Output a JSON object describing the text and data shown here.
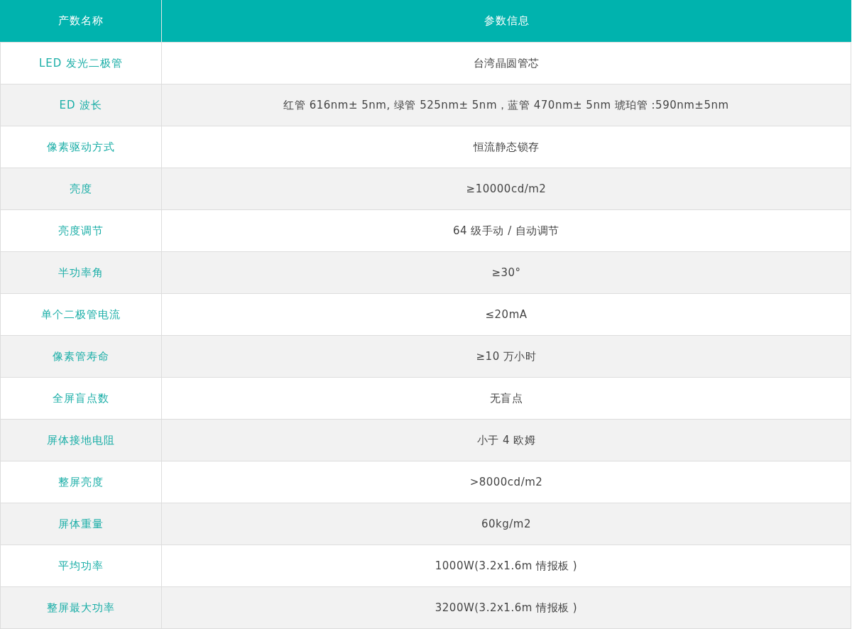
{
  "table": {
    "columns": [
      "产数名称",
      "参数信息"
    ],
    "rows": [
      {
        "name": "LED 发光二极管",
        "value": "台湾晶圆管芯"
      },
      {
        "name": "ED 波长",
        "value": "红管 616nm± 5nm, 绿管 525nm± 5nm，蓝管 470nm± 5nm 琥珀管 :590nm±5nm"
      },
      {
        "name": "像素驱动方式",
        "value": "恒流静态锁存"
      },
      {
        "name": "亮度",
        "value": "≥10000cd/m2"
      },
      {
        "name": "亮度调节",
        "value": "64 级手动 / 自动调节"
      },
      {
        "name": "半功率角",
        "value": "≥30°"
      },
      {
        "name": "单个二极管电流",
        "value": "≤20mA"
      },
      {
        "name": "像素管寿命",
        "value": "≥10 万小时"
      },
      {
        "name": "全屏盲点数",
        "value": "无盲点"
      },
      {
        "name": "屏体接地电阻",
        "value": "小于 4 欧姆"
      },
      {
        "name": "整屏亮度",
        "value": ">8000cd/m2"
      },
      {
        "name": "屏体重量",
        "value": "60kg/m2"
      },
      {
        "name": "平均功率",
        "value": "1000W(3.2x1.6m 情报板 )"
      },
      {
        "name": "整屏最大功率",
        "value": "3200W(3.2x1.6m 情报板 )"
      }
    ]
  }
}
